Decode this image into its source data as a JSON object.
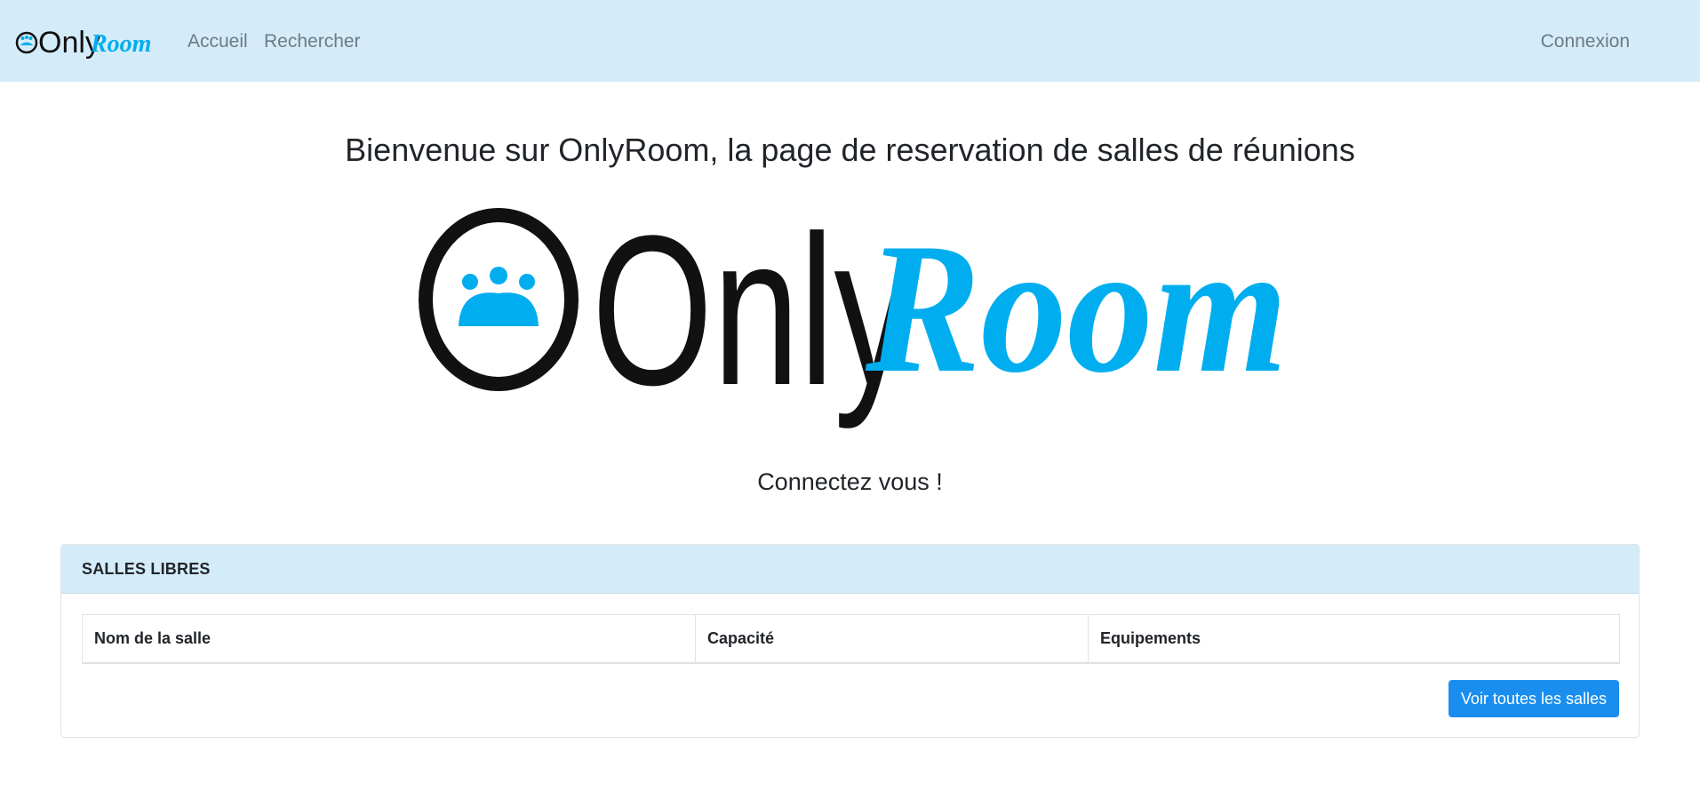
{
  "nav": {
    "brand": {
      "part1": "Only",
      "part2": "Room"
    },
    "links": {
      "home": "Accueil",
      "search": "Rechercher"
    },
    "login": "Connexion"
  },
  "main": {
    "title": "Bienvenue sur OnlyRoom, la page de reservation de salles de réunions",
    "logo": {
      "part1": "Only",
      "part2": "Room"
    },
    "connect_prompt": "Connectez vous !"
  },
  "free_rooms": {
    "header": "SALLES LIBRES",
    "columns": [
      "Nom de la salle",
      "Capacité",
      "Equipements"
    ],
    "rows": [],
    "view_all_button": "Voir toutes les salles"
  },
  "colors": {
    "navbar_bg": "#d4ecf9",
    "brand_accent": "#00aeef",
    "primary_button": "#1a8eef",
    "text": "#212529"
  }
}
